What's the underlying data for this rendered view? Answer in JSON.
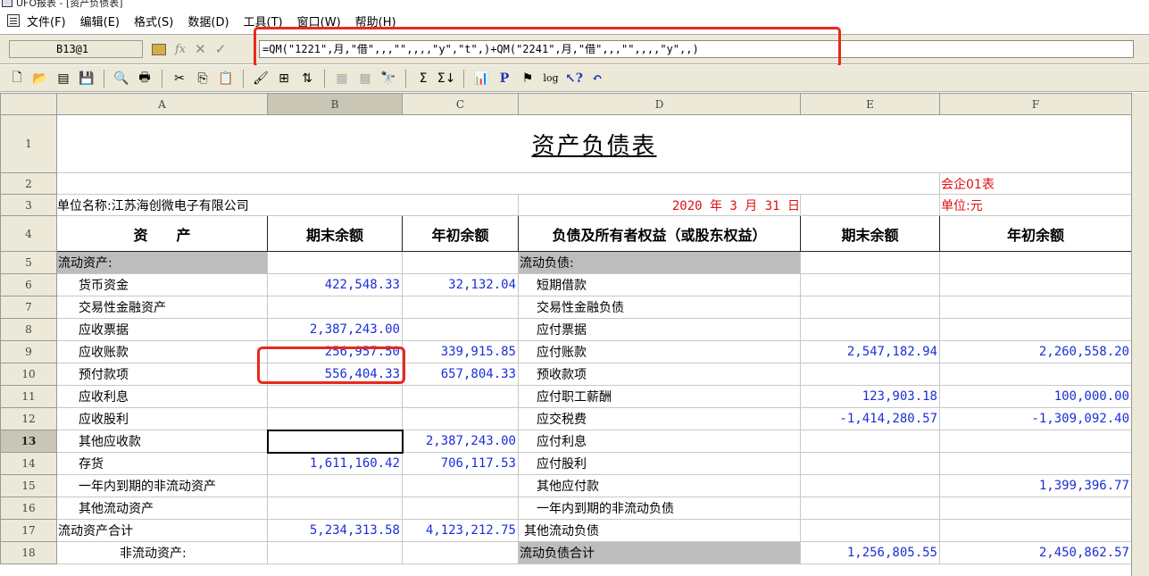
{
  "window": {
    "title": "UFO报表 - [资产负债表]"
  },
  "menu": [
    "文件(F)",
    "编辑(E)",
    "格式(S)",
    "数据(D)",
    "工具(T)",
    "窗口(W)",
    "帮助(H)"
  ],
  "formula_bar": {
    "cell_ref": "B13@1",
    "formula": "=QM(\"1221\",月,\"借\",,,\"\",,,,\"y\",\"t\",)+QM(\"2241\",月,\"借\",,,\"\",,,,\"y\",,)"
  },
  "columns": [
    "A",
    "B",
    "C",
    "D",
    "E",
    "F"
  ],
  "selected_cell": "B13",
  "sheet": {
    "title": "资产负债表",
    "form_no": "会企01表",
    "company": "单位名称:江苏海创微电子有限公司",
    "date": "2020 年  3 月 31 日",
    "unit": "单位:元",
    "headers": [
      "资　　产",
      "期末余额",
      "年初余额",
      "负债及所有者权益（或股东权益）",
      "期末余额",
      "年初余额"
    ],
    "rows": [
      {
        "n": "5",
        "a": "流动资产:",
        "b": "",
        "c": "",
        "d": "流动负债:",
        "e": "",
        "f": ""
      },
      {
        "n": "6",
        "a": "货币资金",
        "b": "422,548.33",
        "c": "32,132.04",
        "d": "短期借款",
        "e": "",
        "f": ""
      },
      {
        "n": "7",
        "a": "交易性金融资产",
        "b": "",
        "c": "",
        "d": "交易性金融负债",
        "e": "",
        "f": ""
      },
      {
        "n": "8",
        "a": "应收票据",
        "b": "2,387,243.00",
        "c": "",
        "d": "应付票据",
        "e": "",
        "f": ""
      },
      {
        "n": "9",
        "a": "应收账款",
        "b": "256,957.50",
        "c": "339,915.85",
        "d": "应付账款",
        "e": "2,547,182.94",
        "f": "2,260,558.20"
      },
      {
        "n": "10",
        "a": "预付款项",
        "b": "556,404.33",
        "c": "657,804.33",
        "d": "预收款项",
        "e": "",
        "f": ""
      },
      {
        "n": "11",
        "a": "应收利息",
        "b": "",
        "c": "",
        "d": "应付职工薪酬",
        "e": "123,903.18",
        "f": "100,000.00"
      },
      {
        "n": "12",
        "a": "应收股利",
        "b": "",
        "c": "",
        "d": "应交税费",
        "e": "-1,414,280.57",
        "f": "-1,309,092.40"
      },
      {
        "n": "13",
        "a": "其他应收款",
        "b": "",
        "c": "2,387,243.00",
        "d": "应付利息",
        "e": "",
        "f": ""
      },
      {
        "n": "14",
        "a": "存货",
        "b": "1,611,160.42",
        "c": "706,117.53",
        "d": "应付股利",
        "e": "",
        "f": ""
      },
      {
        "n": "15",
        "a": "一年内到期的非流动资产",
        "b": "",
        "c": "",
        "d": "其他应付款",
        "e": "",
        "f": "1,399,396.77"
      },
      {
        "n": "16",
        "a": "其他流动资产",
        "b": "",
        "c": "",
        "d": "一年内到期的非流动负债",
        "e": "",
        "f": ""
      },
      {
        "n": "17",
        "a": "流动资产合计",
        "b": "5,234,313.58",
        "c": "4,123,212.75",
        "d": "其他流动负债",
        "e": "",
        "f": ""
      },
      {
        "n": "18",
        "a": "非流动资产:",
        "b": "",
        "c": "",
        "d": "流动负债合计",
        "e": "1,256,805.55",
        "f": "2,450,862.57"
      }
    ]
  }
}
